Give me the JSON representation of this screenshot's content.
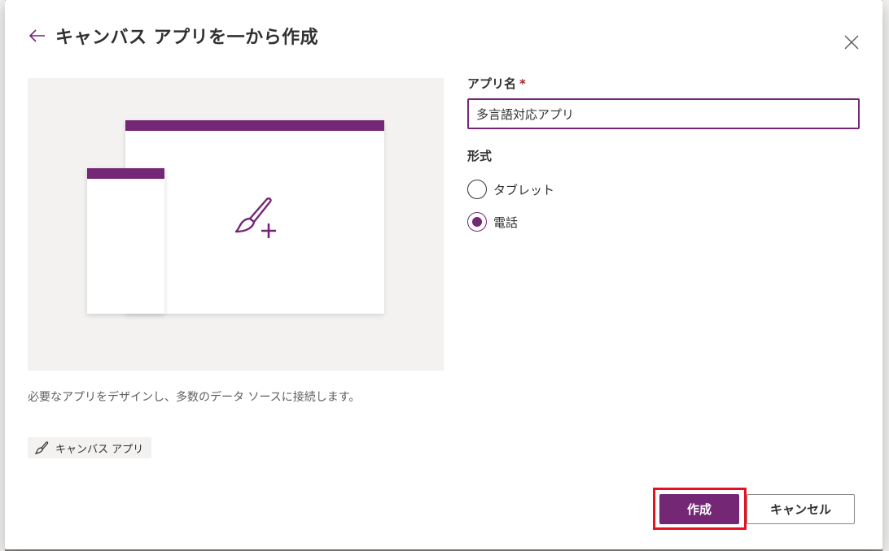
{
  "dialog": {
    "title": "キャンバス アプリを一から作成",
    "back_icon": "arrow-left-icon",
    "close_icon": "close-icon"
  },
  "preview": {
    "description": "必要なアプリをデザインし、多数のデータ ソースに接続します。",
    "tag_label": "キャンバス アプリ",
    "tag_icon": "paintbrush-icon",
    "center_icon": "paintbrush-plus-icon"
  },
  "form": {
    "app_name_label": "アプリ名",
    "required_mark": "*",
    "app_name_value": "多言語対応アプリ",
    "format_label": "形式",
    "options": [
      {
        "label": "タブレット",
        "selected": false
      },
      {
        "label": "電話",
        "selected": true
      }
    ]
  },
  "actions": {
    "create_label": "作成",
    "cancel_label": "キャンセル"
  },
  "colors": {
    "accent": "#742774",
    "highlight": "#e81123"
  }
}
